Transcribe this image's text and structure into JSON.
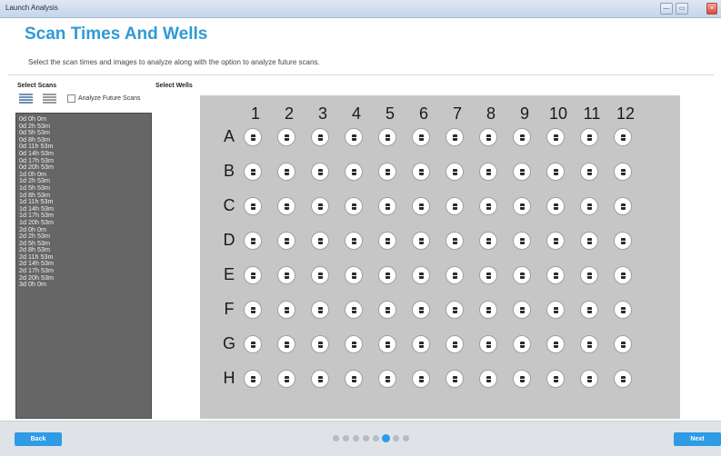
{
  "window": {
    "title": "Launch Analysis",
    "controls": [
      "—",
      "▭",
      "×"
    ]
  },
  "header": {
    "title": "Scan Times And Wells",
    "subtitle": "Select the scan times and images to analyze along with the option to analyze future scans."
  },
  "scans": {
    "label": "Select Scans",
    "analyze_future_label": "Analyze Future Scans",
    "analyze_future_checked": false,
    "items": [
      "0d 0h 0m",
      "0d 2h 53m",
      "0d 5h 53m",
      "0d 8h 53m",
      "0d 11h 53m",
      "0d 14h 53m",
      "0d 17h 53m",
      "0d 20h 53m",
      "1d 0h 0m",
      "1d 2h 53m",
      "1d 5h 53m",
      "1d 8h 53m",
      "1d 11h 53m",
      "1d 14h 53m",
      "1d 17h 53m",
      "1d 20h 53m",
      "2d 0h 0m",
      "2d 2h 53m",
      "2d 5h 53m",
      "2d 8h 53m",
      "2d 11h 53m",
      "2d 14h 53m",
      "2d 17h 53m",
      "2d 20h 53m",
      "3d 0h 0m"
    ]
  },
  "wells": {
    "label": "Select Wells",
    "columns": [
      "1",
      "2",
      "3",
      "4",
      "5",
      "6",
      "7",
      "8",
      "9",
      "10",
      "11",
      "12"
    ],
    "rows": [
      "A",
      "B",
      "C",
      "D",
      "E",
      "F",
      "G",
      "H"
    ]
  },
  "footer": {
    "back_label": "Back",
    "next_label": "Next",
    "page_count": 8,
    "current_page": 6
  },
  "colors": {
    "accent": "#2f9be4",
    "title": "#2e9ad6",
    "list_bg": "#666666",
    "wells_bg": "#c6c6c6"
  }
}
